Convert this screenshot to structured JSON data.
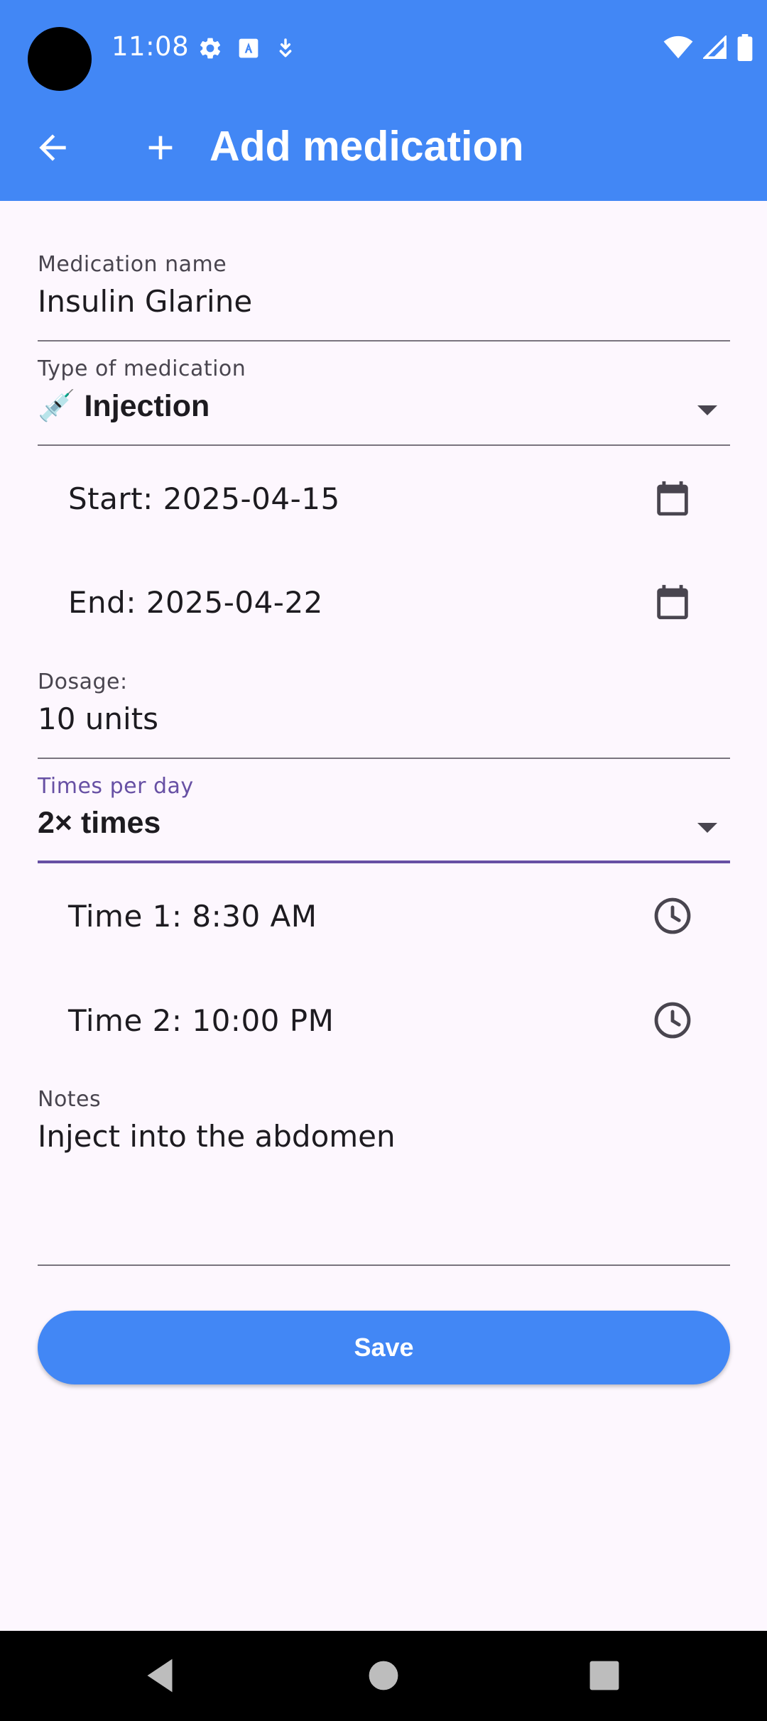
{
  "status_bar": {
    "time": "11:08",
    "icons_left": [
      "gear-icon",
      "a-box-icon",
      "download-icon"
    ],
    "icons_right": [
      "wifi-icon",
      "signal-icon",
      "battery-icon"
    ]
  },
  "app_bar": {
    "title": "Add medication",
    "back_icon": "arrow-back-icon",
    "title_icon": "plus-icon",
    "color": "#4287f5"
  },
  "form": {
    "medication_name": {
      "label": "Medication name",
      "value": "Insulin Glarine"
    },
    "type": {
      "label": "Type of medication",
      "value": "💉 Injection"
    },
    "start_date": {
      "text": "Start: 2025-04-15",
      "icon": "calendar-icon"
    },
    "end_date": {
      "text": "End: 2025-04-22",
      "icon": "calendar-icon"
    },
    "dosage": {
      "label": "Dosage:",
      "value": "10 units"
    },
    "times_per_day": {
      "label": "Times per day",
      "value": "2× times",
      "accent": "#6750a4"
    },
    "times": [
      {
        "text": "Time 1: 8:30 AM",
        "icon": "clock-icon"
      },
      {
        "text": "Time 2: 10:00 PM",
        "icon": "clock-icon"
      }
    ],
    "notes": {
      "label": "Notes",
      "value": "Inject into the abdomen"
    },
    "save_label": "Save"
  },
  "nav_bar": [
    "back-triangle-icon",
    "home-circle-icon",
    "recents-square-icon"
  ]
}
